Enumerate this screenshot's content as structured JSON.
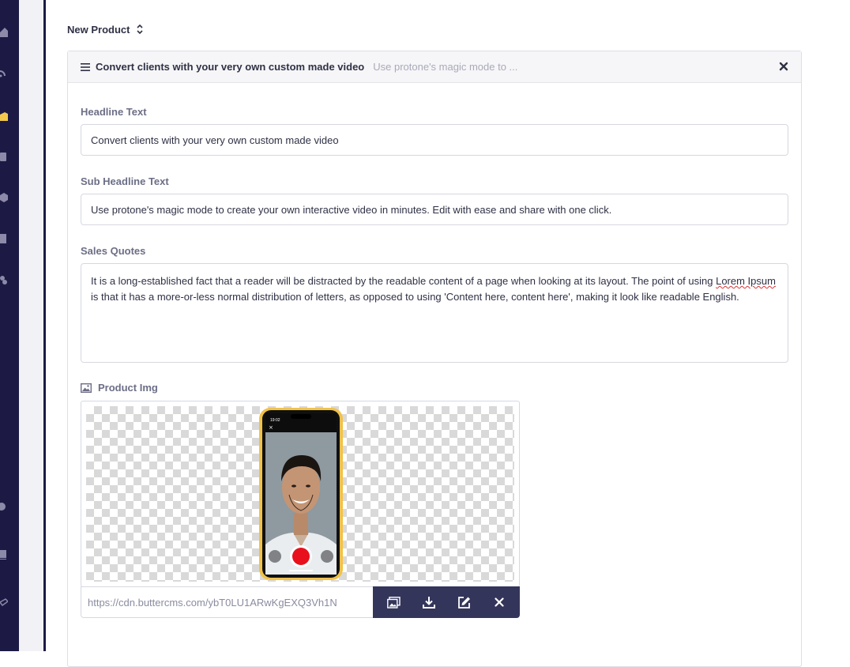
{
  "page": {
    "title": "New Product"
  },
  "card": {
    "header_title": "Convert clients with your very own custom made video",
    "header_subtitle": "Use protone's magic mode to ..."
  },
  "fields": {
    "headline": {
      "label": "Headline Text",
      "value": "Convert clients with your very own custom made video"
    },
    "sub_headline": {
      "label": "Sub Headline Text",
      "value": "Use protone's magic mode to create your own interactive video in minutes. Edit with ease and share with one click."
    },
    "sales_quotes": {
      "label": "Sales Quotes",
      "value_before": "It is a long-established fact that a reader will be distracted by the readable content of a page when looking at its layout. The point of using ",
      "value_misspelled": "Lorem Ipsum",
      "value_after": " is that it has a more-or-less normal distribution of letters, as opposed to using 'Content here, content here', making it look like readable English."
    },
    "product_img": {
      "label": "Product Img",
      "url": "https://cdn.buttercms.com/ybT0LU1ARwKgEXQ3Vh1N",
      "phone_time": "19:02"
    }
  },
  "icons": {
    "sort": "chevron-up-down-icon",
    "menu": "hamburger-menu-icon",
    "close": "close-x-icon",
    "image_label": "image-icon",
    "actions": [
      "media-library-icon",
      "download-icon",
      "edit-icon",
      "remove-icon"
    ]
  },
  "colors": {
    "sidebar": "#1c1a45",
    "accent_active": "#f2c94c",
    "toolbar": "#34355a",
    "label": "#6c6e86",
    "record_button": "#e8101c"
  }
}
